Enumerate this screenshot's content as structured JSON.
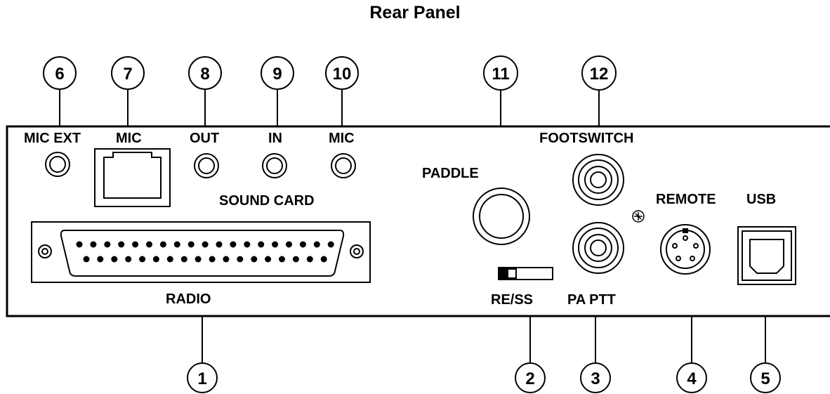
{
  "title": "Rear Panel",
  "panel_labels": {
    "mic_ext": "MIC EXT",
    "mic": "MIC",
    "out": "OUT",
    "in": "IN",
    "mic_sound": "MIC",
    "sound_card": "SOUND CARD",
    "radio": "RADIO",
    "paddle": "PADDLE",
    "footswitch": "FOOTSWITCH",
    "remote": "REMOTE",
    "usb": "USB",
    "re_ss": "RE/SS",
    "pa_ptt": "PA PTT"
  },
  "callouts": {
    "c1": "1",
    "c2": "2",
    "c3": "3",
    "c4": "4",
    "c5": "5",
    "c6": "6",
    "c7": "7",
    "c8": "8",
    "c9": "9",
    "c10": "10",
    "c11": "11",
    "c12": "12"
  }
}
